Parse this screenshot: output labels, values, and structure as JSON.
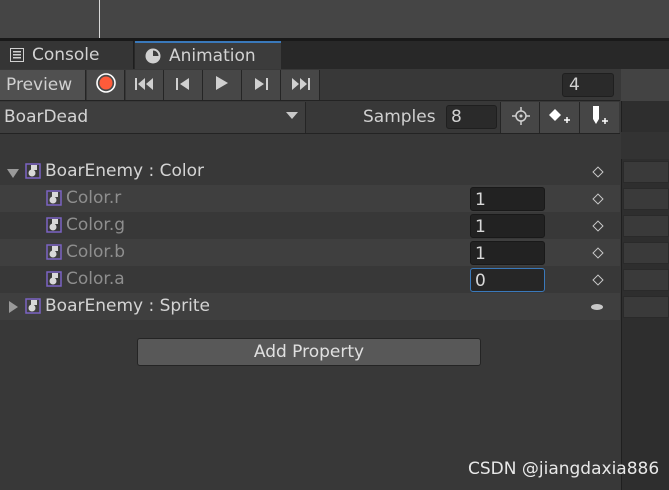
{
  "tabs": {
    "console": "Console",
    "animation": "Animation"
  },
  "toolbar": {
    "preview_label": "Preview",
    "frame_value": "4",
    "clip_name": "BoarDead",
    "samples_label": "Samples",
    "samples_value": "8"
  },
  "properties": {
    "group_color": {
      "label": "BoarEnemy : Color",
      "children": [
        {
          "label": "Color.r",
          "value": "1"
        },
        {
          "label": "Color.g",
          "value": "1"
        },
        {
          "label": "Color.b",
          "value": "1"
        },
        {
          "label": "Color.a",
          "value": "0"
        }
      ]
    },
    "group_sprite": {
      "label": "BoarEnemy : Sprite"
    }
  },
  "add_property_label": "Add Property",
  "watermark": "CSDN @jiangdaxia886",
  "colors": {
    "accent": "#3a79bb",
    "record": "#ff5b3a",
    "icon_purple": "#7b63c4"
  }
}
